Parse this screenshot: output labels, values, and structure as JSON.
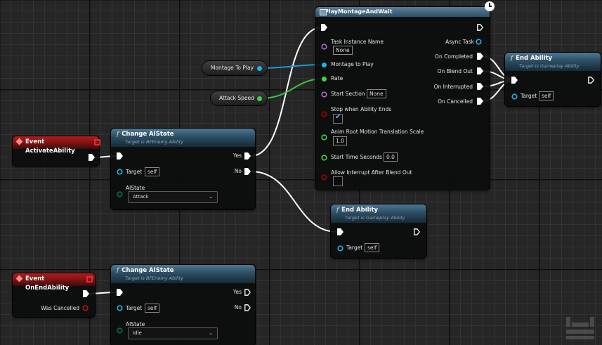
{
  "colors": {
    "exec": "#ffffff",
    "object": "#1eb1ea",
    "float": "#3dd34a",
    "purple": "#b06ad8",
    "bool": "#a30000",
    "event_header": "#9a1818",
    "function_header": "#2c4d63"
  },
  "variables": {
    "montage": "Montage To Play",
    "speed": "Attack Speed"
  },
  "event_activate": {
    "title": "Event ActivateAbility"
  },
  "event_end": {
    "title": "Event OnEndAbility",
    "was_cancelled": "Was Cancelled"
  },
  "change_state_1": {
    "title": "Change AIState",
    "subtitle": "Target is BFEnemy Ability",
    "yes": "Yes",
    "no": "No",
    "target_label": "Target",
    "target_value": "self",
    "state_label": "AIState",
    "state_value": "Attack"
  },
  "change_state_2": {
    "title": "Change AIState",
    "subtitle": "Target is BFEnemy Ability",
    "yes": "Yes",
    "no": "No",
    "target_label": "Target",
    "target_value": "self",
    "state_label": "AIState",
    "state_value": "Idle"
  },
  "montage": {
    "title": "PlayMontageAndWait",
    "task_instance_label": "Task Instance Name",
    "task_instance_value": "None",
    "async_task": "Async Task",
    "montage_to_play": "Montage to Play",
    "rate": "Rate",
    "start_section_label": "Start Section",
    "start_section_value": "None",
    "stop_when_ends": "Stop when Ability Ends",
    "root_motion_label": "Anim Root Motion Translation Scale",
    "root_motion_value": "1.0",
    "start_time_label": "Start Time Seconds",
    "start_time_value": "0.0",
    "allow_interrupt": "Allow Interrupt After Blend Out",
    "on_completed": "On Completed",
    "on_blend_out": "On Blend Out",
    "on_interrupted": "On Interrupted",
    "on_cancelled": "On Cancelled"
  },
  "end_ability_1": {
    "title": "End Ability",
    "subtitle": "Target is Gameplay Ability",
    "target_label": "Target",
    "target_value": "self"
  },
  "end_ability_2": {
    "title": "End Ability",
    "subtitle": "Target is Gameplay Ability",
    "target_label": "Target",
    "target_value": "self"
  }
}
